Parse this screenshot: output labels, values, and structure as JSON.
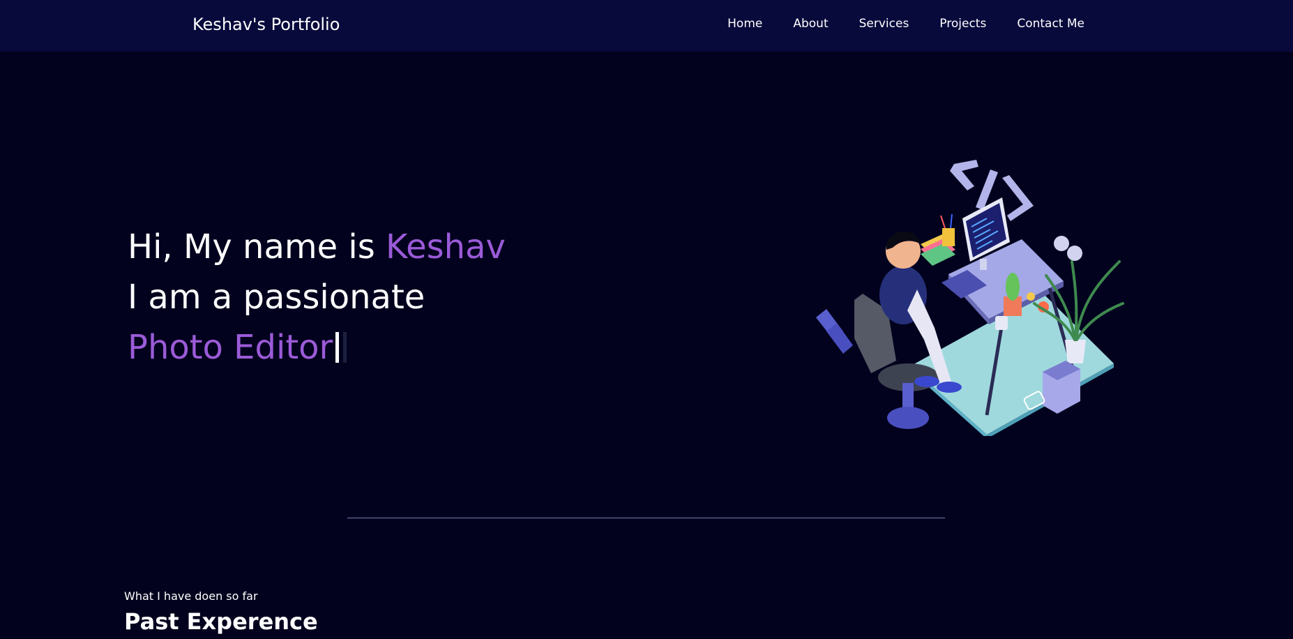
{
  "header": {
    "brand": "Keshav's Portfolio",
    "nav": [
      {
        "label": "Home"
      },
      {
        "label": "About"
      },
      {
        "label": "Services"
      },
      {
        "label": "Projects"
      },
      {
        "label": "Contact Me"
      }
    ]
  },
  "hero": {
    "greeting_prefix": "Hi, My name is ",
    "name": "Keshav",
    "line2": "I am a passionate",
    "role": "Photo Editor",
    "illustration_icon": "developer-at-desk-illustration"
  },
  "experience": {
    "subtitle": "What I have doen so far",
    "title": "Past Experence"
  },
  "colors": {
    "background": "#02021e",
    "navbar": "#080a3c",
    "accent": "#9b5bd8",
    "divider": "#7a7db8"
  }
}
